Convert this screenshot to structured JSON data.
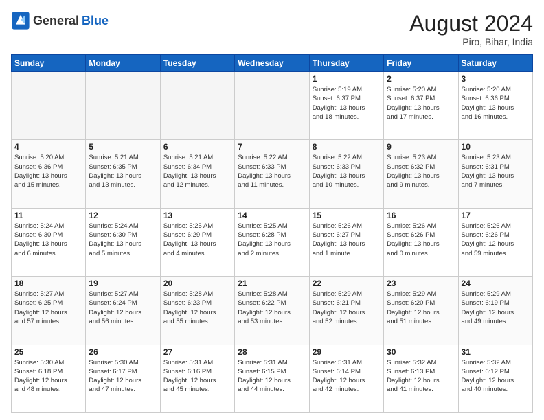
{
  "header": {
    "logo_general": "General",
    "logo_blue": "Blue",
    "month_year": "August 2024",
    "location": "Piro, Bihar, India"
  },
  "days_of_week": [
    "Sunday",
    "Monday",
    "Tuesday",
    "Wednesday",
    "Thursday",
    "Friday",
    "Saturday"
  ],
  "weeks": [
    [
      {
        "day": "",
        "info": ""
      },
      {
        "day": "",
        "info": ""
      },
      {
        "day": "",
        "info": ""
      },
      {
        "day": "",
        "info": ""
      },
      {
        "day": "1",
        "info": "Sunrise: 5:19 AM\nSunset: 6:37 PM\nDaylight: 13 hours\nand 18 minutes."
      },
      {
        "day": "2",
        "info": "Sunrise: 5:20 AM\nSunset: 6:37 PM\nDaylight: 13 hours\nand 17 minutes."
      },
      {
        "day": "3",
        "info": "Sunrise: 5:20 AM\nSunset: 6:36 PM\nDaylight: 13 hours\nand 16 minutes."
      }
    ],
    [
      {
        "day": "4",
        "info": "Sunrise: 5:20 AM\nSunset: 6:36 PM\nDaylight: 13 hours\nand 15 minutes."
      },
      {
        "day": "5",
        "info": "Sunrise: 5:21 AM\nSunset: 6:35 PM\nDaylight: 13 hours\nand 13 minutes."
      },
      {
        "day": "6",
        "info": "Sunrise: 5:21 AM\nSunset: 6:34 PM\nDaylight: 13 hours\nand 12 minutes."
      },
      {
        "day": "7",
        "info": "Sunrise: 5:22 AM\nSunset: 6:33 PM\nDaylight: 13 hours\nand 11 minutes."
      },
      {
        "day": "8",
        "info": "Sunrise: 5:22 AM\nSunset: 6:33 PM\nDaylight: 13 hours\nand 10 minutes."
      },
      {
        "day": "9",
        "info": "Sunrise: 5:23 AM\nSunset: 6:32 PM\nDaylight: 13 hours\nand 9 minutes."
      },
      {
        "day": "10",
        "info": "Sunrise: 5:23 AM\nSunset: 6:31 PM\nDaylight: 13 hours\nand 7 minutes."
      }
    ],
    [
      {
        "day": "11",
        "info": "Sunrise: 5:24 AM\nSunset: 6:30 PM\nDaylight: 13 hours\nand 6 minutes."
      },
      {
        "day": "12",
        "info": "Sunrise: 5:24 AM\nSunset: 6:30 PM\nDaylight: 13 hours\nand 5 minutes."
      },
      {
        "day": "13",
        "info": "Sunrise: 5:25 AM\nSunset: 6:29 PM\nDaylight: 13 hours\nand 4 minutes."
      },
      {
        "day": "14",
        "info": "Sunrise: 5:25 AM\nSunset: 6:28 PM\nDaylight: 13 hours\nand 2 minutes."
      },
      {
        "day": "15",
        "info": "Sunrise: 5:26 AM\nSunset: 6:27 PM\nDaylight: 13 hours\nand 1 minute."
      },
      {
        "day": "16",
        "info": "Sunrise: 5:26 AM\nSunset: 6:26 PM\nDaylight: 13 hours\nand 0 minutes."
      },
      {
        "day": "17",
        "info": "Sunrise: 5:26 AM\nSunset: 6:26 PM\nDaylight: 12 hours\nand 59 minutes."
      }
    ],
    [
      {
        "day": "18",
        "info": "Sunrise: 5:27 AM\nSunset: 6:25 PM\nDaylight: 12 hours\nand 57 minutes."
      },
      {
        "day": "19",
        "info": "Sunrise: 5:27 AM\nSunset: 6:24 PM\nDaylight: 12 hours\nand 56 minutes."
      },
      {
        "day": "20",
        "info": "Sunrise: 5:28 AM\nSunset: 6:23 PM\nDaylight: 12 hours\nand 55 minutes."
      },
      {
        "day": "21",
        "info": "Sunrise: 5:28 AM\nSunset: 6:22 PM\nDaylight: 12 hours\nand 53 minutes."
      },
      {
        "day": "22",
        "info": "Sunrise: 5:29 AM\nSunset: 6:21 PM\nDaylight: 12 hours\nand 52 minutes."
      },
      {
        "day": "23",
        "info": "Sunrise: 5:29 AM\nSunset: 6:20 PM\nDaylight: 12 hours\nand 51 minutes."
      },
      {
        "day": "24",
        "info": "Sunrise: 5:29 AM\nSunset: 6:19 PM\nDaylight: 12 hours\nand 49 minutes."
      }
    ],
    [
      {
        "day": "25",
        "info": "Sunrise: 5:30 AM\nSunset: 6:18 PM\nDaylight: 12 hours\nand 48 minutes."
      },
      {
        "day": "26",
        "info": "Sunrise: 5:30 AM\nSunset: 6:17 PM\nDaylight: 12 hours\nand 47 minutes."
      },
      {
        "day": "27",
        "info": "Sunrise: 5:31 AM\nSunset: 6:16 PM\nDaylight: 12 hours\nand 45 minutes."
      },
      {
        "day": "28",
        "info": "Sunrise: 5:31 AM\nSunset: 6:15 PM\nDaylight: 12 hours\nand 44 minutes."
      },
      {
        "day": "29",
        "info": "Sunrise: 5:31 AM\nSunset: 6:14 PM\nDaylight: 12 hours\nand 42 minutes."
      },
      {
        "day": "30",
        "info": "Sunrise: 5:32 AM\nSunset: 6:13 PM\nDaylight: 12 hours\nand 41 minutes."
      },
      {
        "day": "31",
        "info": "Sunrise: 5:32 AM\nSunset: 6:12 PM\nDaylight: 12 hours\nand 40 minutes."
      }
    ]
  ]
}
